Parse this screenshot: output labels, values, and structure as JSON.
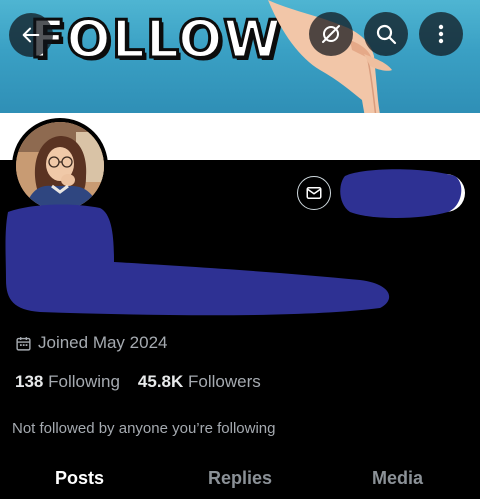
{
  "banner": {
    "text": "FOLLOW"
  },
  "header": {
    "back_icon": "arrow-left-icon",
    "icons": [
      "no-sync-icon",
      "search-icon",
      "more-vertical-icon"
    ]
  },
  "profile": {
    "joined_text": "Joined May 2024",
    "joined_icon": "calendar-icon",
    "following_count": "138",
    "following_label": "Following",
    "followers_count": "45.8K",
    "followers_label": "Followers",
    "followed_by_note": "Not followed by anyone you’re following",
    "message_icon": "mail-icon"
  },
  "tabs": {
    "posts": "Posts",
    "replies": "Replies",
    "media": "Media"
  },
  "colors": {
    "background": "#000000",
    "primary_text": "#e7e9ea",
    "secondary_text": "#a5aab0",
    "redaction": "#2e3193",
    "banner": "#3aa0c4"
  }
}
